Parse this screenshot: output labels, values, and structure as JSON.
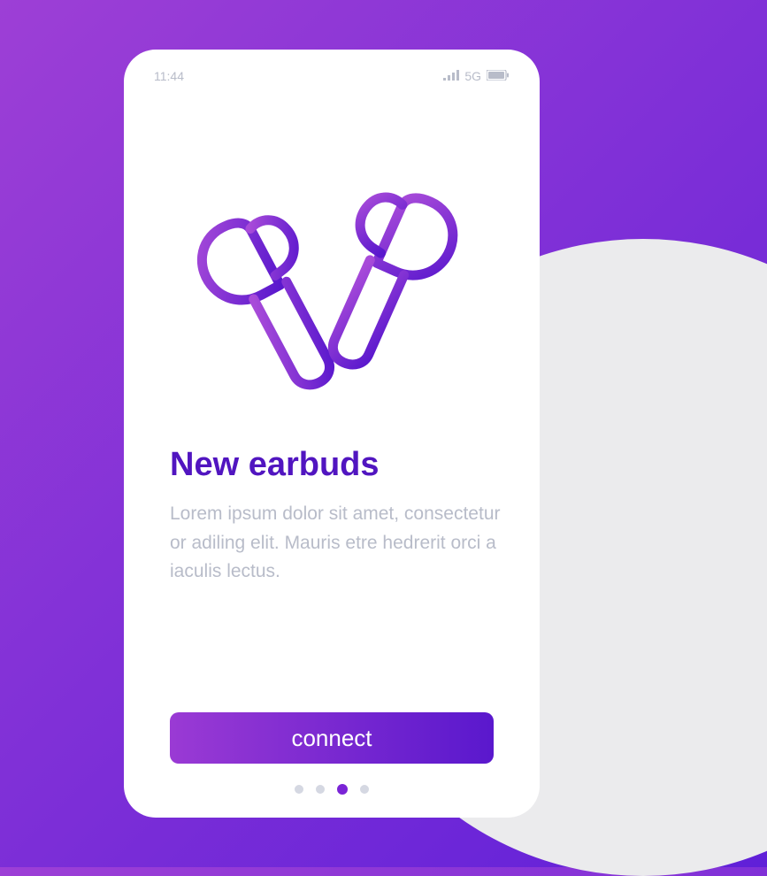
{
  "status_bar": {
    "time": "11:44",
    "network": "5G"
  },
  "hero": {
    "icon": "earbuds-icon"
  },
  "content": {
    "title": "New earbuds",
    "body": "Lorem ipsum dolor sit amet, consectetur or adiling elit. Mauris etre hedrerit orci a iaculis lectus."
  },
  "button": {
    "label": "connect"
  },
  "pagination": {
    "total": 4,
    "active_index": 2
  },
  "colors": {
    "primary_gradient_start": "#9a3ad4",
    "primary_gradient_end": "#5a18cd",
    "title": "#5115c0",
    "muted": "#b8bcc9"
  }
}
